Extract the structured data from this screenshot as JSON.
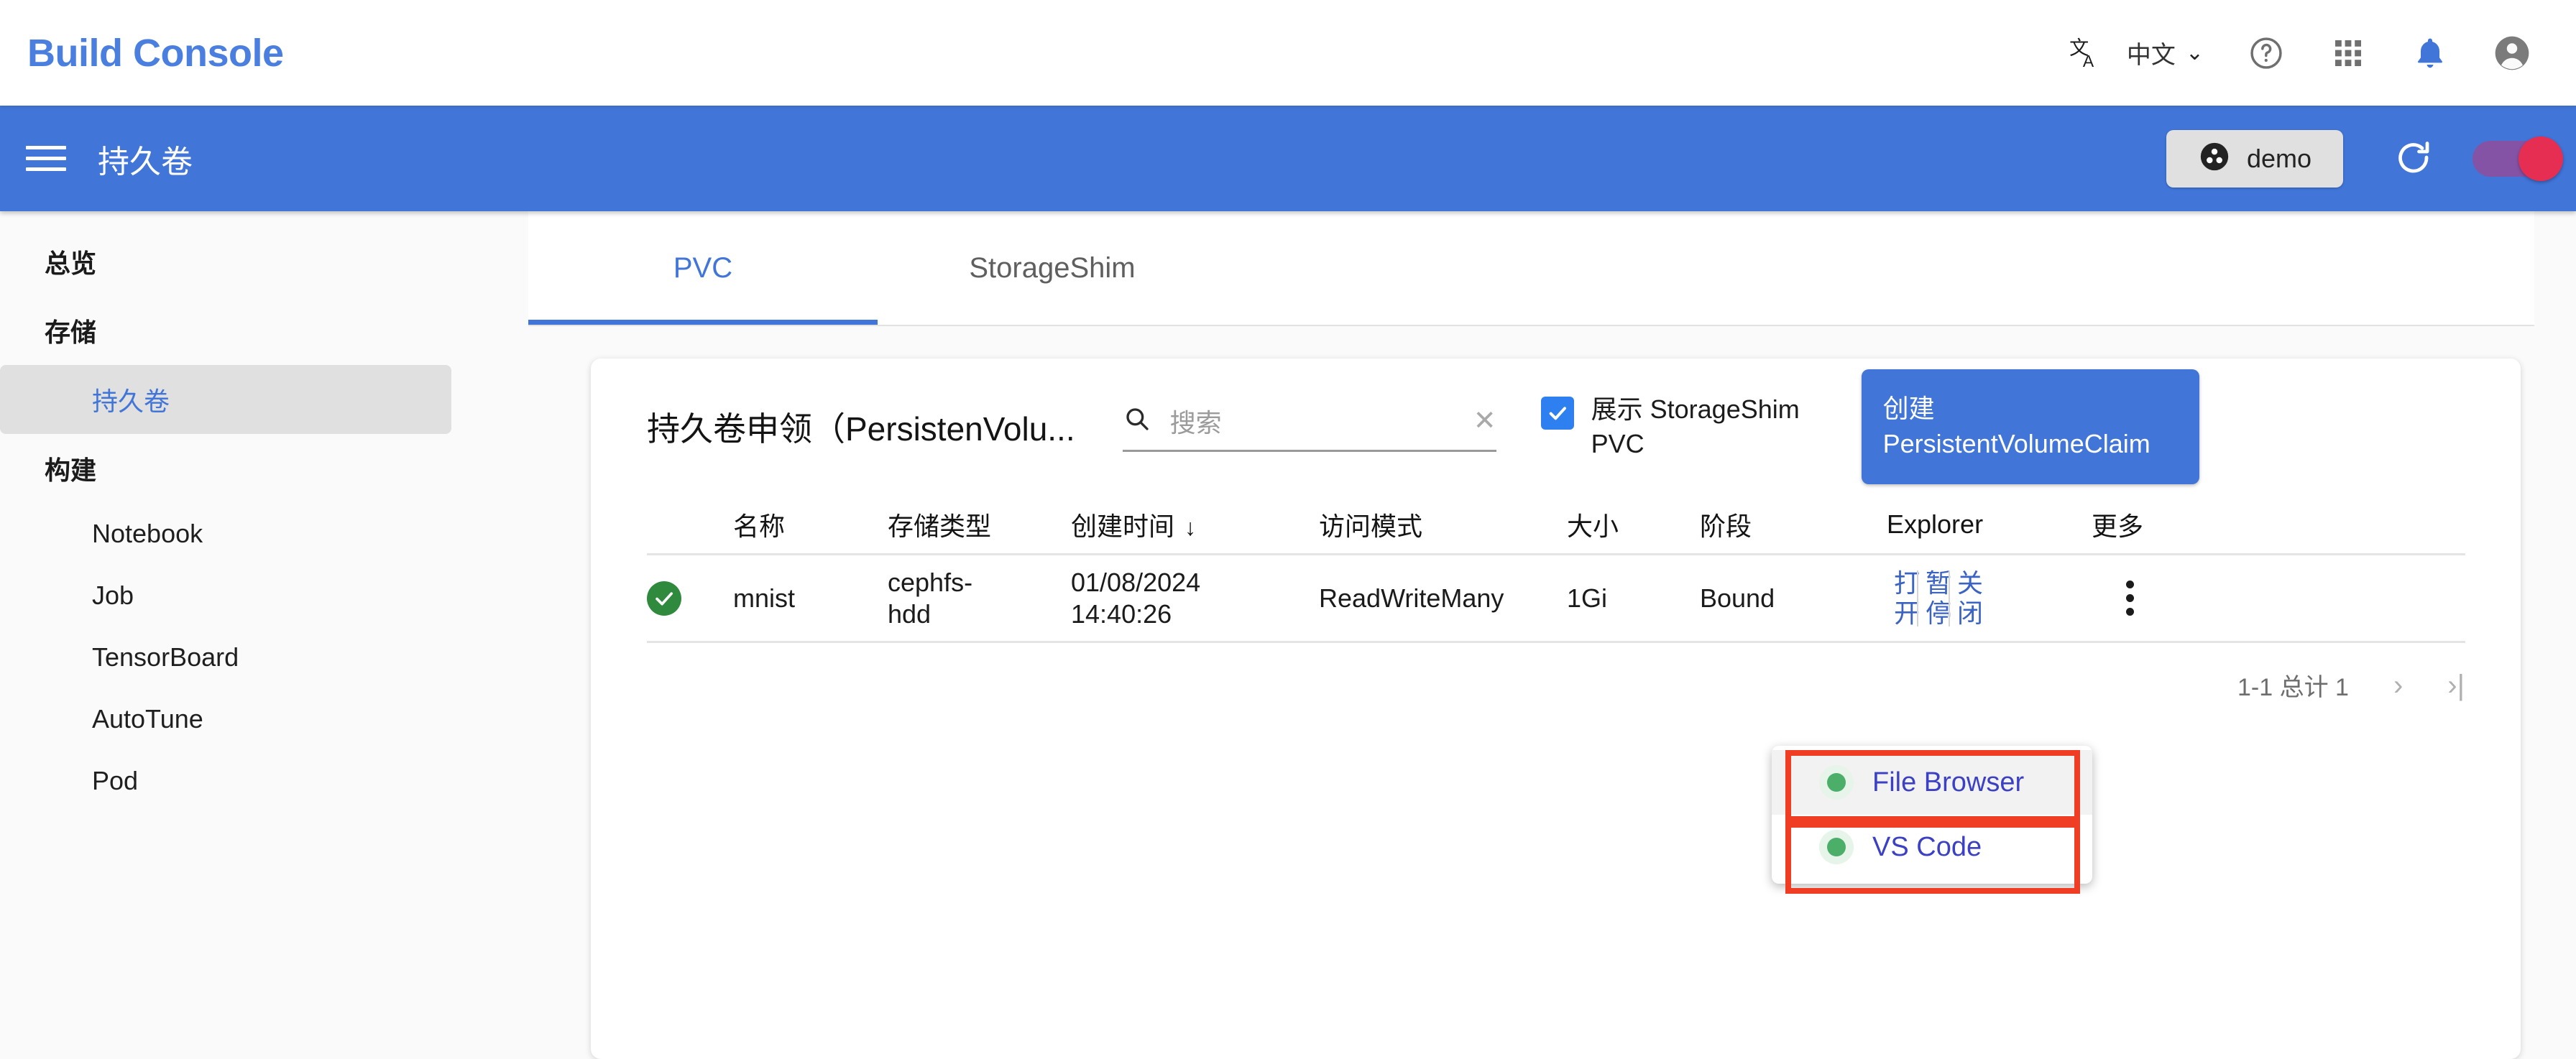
{
  "topbar": {
    "brand": "Build Console",
    "lang": {
      "label": "中文",
      "icon": "translate-icon",
      "chevron": "⌄"
    },
    "icons": [
      {
        "name": "help-icon"
      },
      {
        "name": "apps-grid-icon"
      },
      {
        "name": "notifications-bell-icon"
      },
      {
        "name": "account-circle-icon"
      }
    ]
  },
  "appbar": {
    "menu_icon": "hamburger-menu-icon",
    "title": "持久卷",
    "namespace_chip": {
      "label": "demo",
      "icon": "namespace-icon"
    },
    "refresh_icon": "refresh-icon",
    "theme_toggle": {
      "state": "on",
      "track_color": "#8e4f9e",
      "thumb_color": "#e62e52"
    }
  },
  "sidebar": {
    "items": [
      {
        "label": "总览",
        "type": "section",
        "active": false
      },
      {
        "label": "存储",
        "type": "section",
        "active": false
      },
      {
        "label": "持久卷",
        "type": "item",
        "active": true
      },
      {
        "label": "构建",
        "type": "section",
        "active": false
      },
      {
        "label": "Notebook",
        "type": "item",
        "active": false
      },
      {
        "label": "Job",
        "type": "item",
        "active": false
      },
      {
        "label": "TensorBoard",
        "type": "item",
        "active": false
      },
      {
        "label": "AutoTune",
        "type": "item",
        "active": false
      },
      {
        "label": "Pod",
        "type": "item",
        "active": false
      }
    ]
  },
  "tabs": [
    {
      "label": "PVC",
      "active": true
    },
    {
      "label": "StorageShim",
      "active": false
    }
  ],
  "card": {
    "title": "持久卷申领（PersistenVolu...",
    "search": {
      "placeholder": "搜索",
      "value": "",
      "icon": "search-icon",
      "clear_icon": "✕"
    },
    "checkbox": {
      "label": "展示 StorageShim PVC",
      "checked": true
    },
    "create_button": {
      "line1": "创建",
      "line2": "PersistentVolumeClaim"
    }
  },
  "table": {
    "columns": [
      "名称",
      "存储类型",
      "创建时间",
      "访问模式",
      "大小",
      "阶段",
      "Explorer",
      "更多"
    ],
    "sort": {
      "column": "创建时间",
      "direction": "↓"
    },
    "rows": [
      {
        "status": "✓",
        "name": "mnist",
        "storage_class_line1": "cephfs-",
        "storage_class_line2": "hdd",
        "created_date": "01/08/2024",
        "created_time": "14:40:26",
        "access_mode": "ReadWriteMany",
        "size": "1Gi",
        "phase": "Bound",
        "explorer_actions": [
          {
            "line1": "打",
            "line2": "开"
          },
          {
            "line1": "暂",
            "line2": "停"
          },
          {
            "line1": "关",
            "line2": "闭"
          }
        ],
        "more_icon": "more-vert-icon"
      }
    ]
  },
  "pagination": {
    "info": "1-1 总计 1",
    "next_label": "›",
    "last_label": "›|"
  },
  "dropdown_menu": {
    "items": [
      {
        "label": "File Browser",
        "status": "running",
        "hovered": true
      },
      {
        "label": "VS Code",
        "status": "running",
        "hovered": false
      }
    ],
    "highlight_color": "#ef3e23"
  },
  "colors": {
    "brand_blue": "#4175d8",
    "link_blue": "#3b63c4",
    "success_green": "#2f8a3e",
    "status_dot_green": "#4caf69",
    "annotation_red": "#ef3e23"
  }
}
